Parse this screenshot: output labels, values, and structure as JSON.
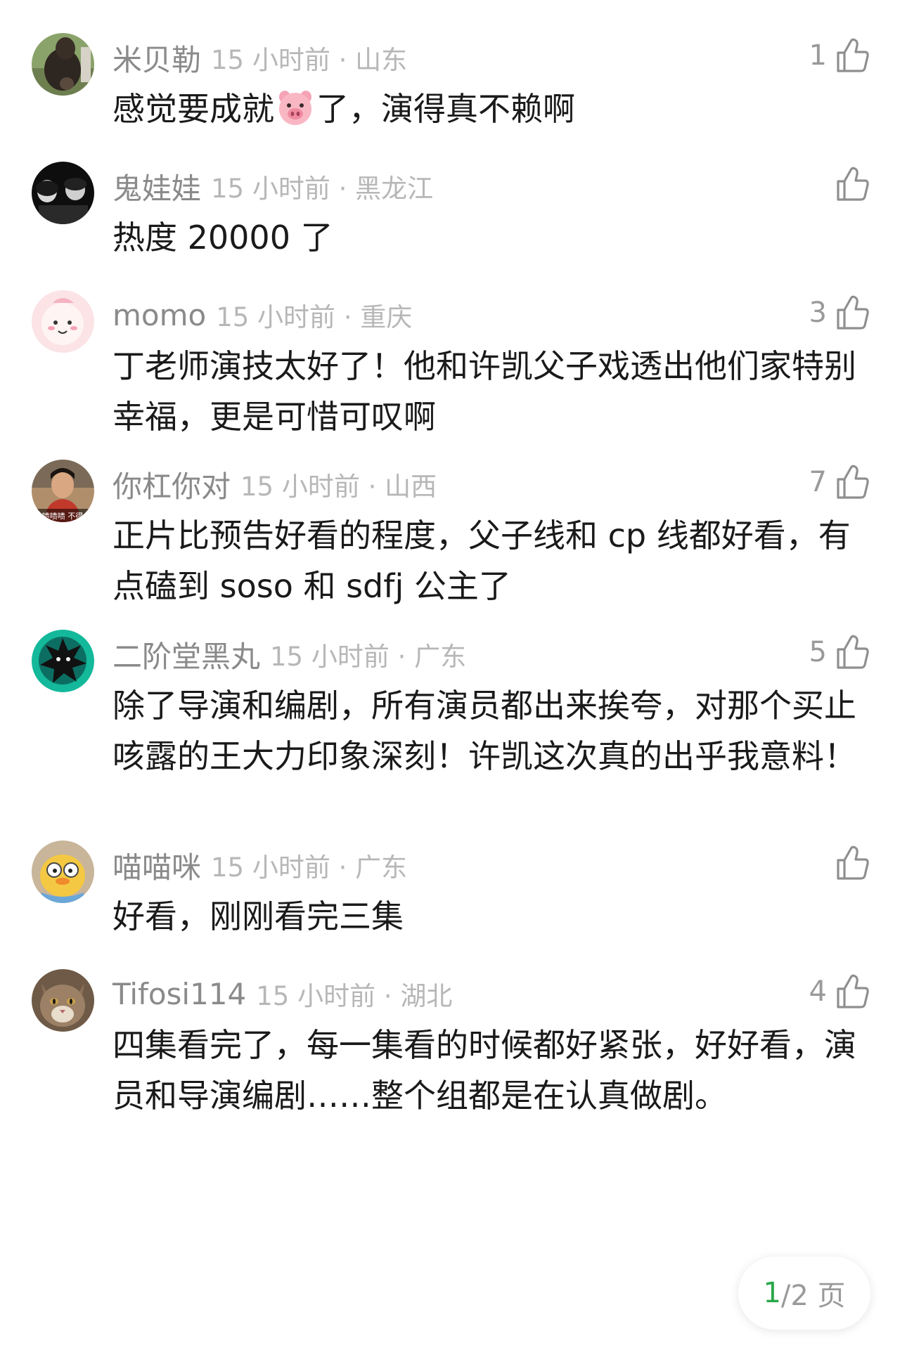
{
  "comments": [
    {
      "user": "米贝勒",
      "meta": "15 小时前 · 山东",
      "likes": "1",
      "text_before": "感觉要成就",
      "text_after": "了，演得真不赖啊"
    },
    {
      "user": "鬼娃娃",
      "meta": "15 小时前 · 黑龙江",
      "likes": "",
      "text": "热度 20000 了"
    },
    {
      "user": "momo",
      "meta": "15 小时前 · 重庆",
      "likes": "3",
      "text": "丁老师演技太好了！他和许凯父子戏透出他们家特别幸福，更是可惜可叹啊"
    },
    {
      "user": "你杠你对",
      "meta": "15 小时前 · 山西",
      "likes": "7",
      "text": "正片比预告好看的程度，父子线和 cp 线都好看，有点磕到 soso 和 sdfj 公主了",
      "avatar_caption": "啧啧啧 不得"
    },
    {
      "user": "二阶堂黑丸",
      "meta": "15 小时前 · 广东",
      "likes": "5",
      "text": "除了导演和编剧，所有演员都出来挨夸，对那个买止咳露的王大力印象深刻！许凯这次真的出乎我意料！"
    },
    {
      "user": "喵喵咪",
      "meta": "15 小时前 · 广东",
      "likes": "",
      "text": "好看，刚刚看完三集"
    },
    {
      "user": "Tifosi114",
      "meta": "15 小时前 · 湖北",
      "likes": "4",
      "text": "四集看完了，每一集看的时候都好紧张，好好看，演员和导演编剧……整个组都是在认真做剧。"
    }
  ],
  "pager": {
    "current": "1",
    "total": "/2 页"
  },
  "colors": {
    "accent": "#2aa84a",
    "username": "#8a8a8a",
    "meta": "#b7b7b7",
    "text": "#1a1a1a"
  },
  "icons": {
    "like": "thumbs-up-icon",
    "emoji": "pig-face-emoji-icon"
  }
}
